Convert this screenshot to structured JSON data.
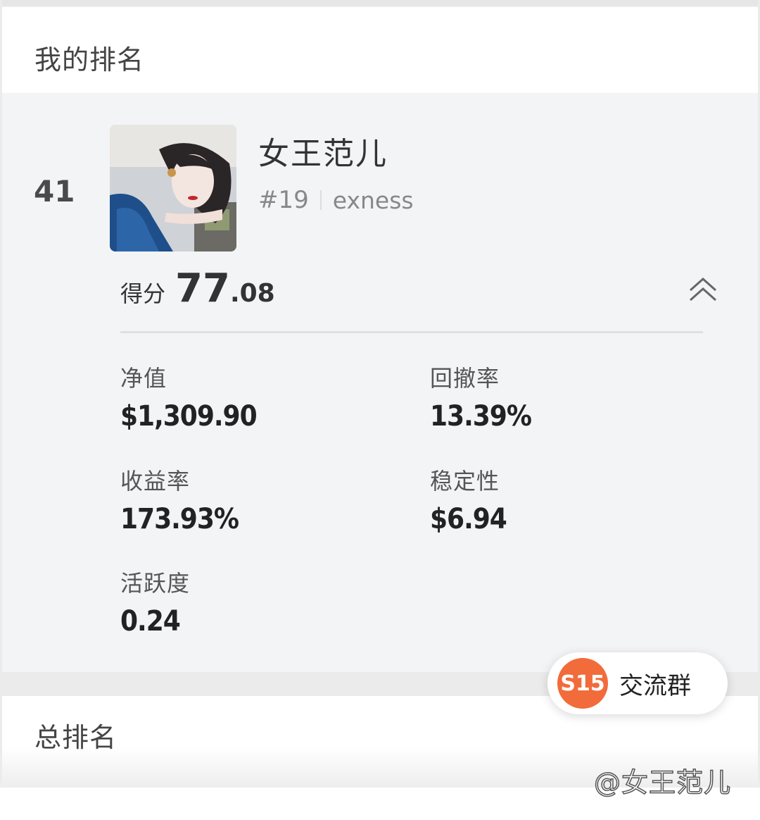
{
  "my_ranking": {
    "title": "我的排名",
    "rank": "41",
    "user": {
      "name": "女王范儿",
      "number": "#19",
      "broker": "exness"
    },
    "score": {
      "label": "得分",
      "integer": "77",
      "decimal": ".08"
    },
    "stats": [
      {
        "label": "净值",
        "value": "$1,309.90"
      },
      {
        "label": "回撤率",
        "value": "13.39%"
      },
      {
        "label": "收益率",
        "value": "173.93%"
      },
      {
        "label": "稳定性",
        "value": "$6.94"
      },
      {
        "label": "活跃度",
        "value": "0.24"
      }
    ],
    "collapse_icon": "chevron-double-up-icon"
  },
  "total_ranking": {
    "title": "总排名"
  },
  "floating_button": {
    "badge": "S15",
    "label": "交流群"
  },
  "watermark": "@女王范儿",
  "colors": {
    "badge": "#f26b3a",
    "card_bg": "#f3f4f6"
  }
}
